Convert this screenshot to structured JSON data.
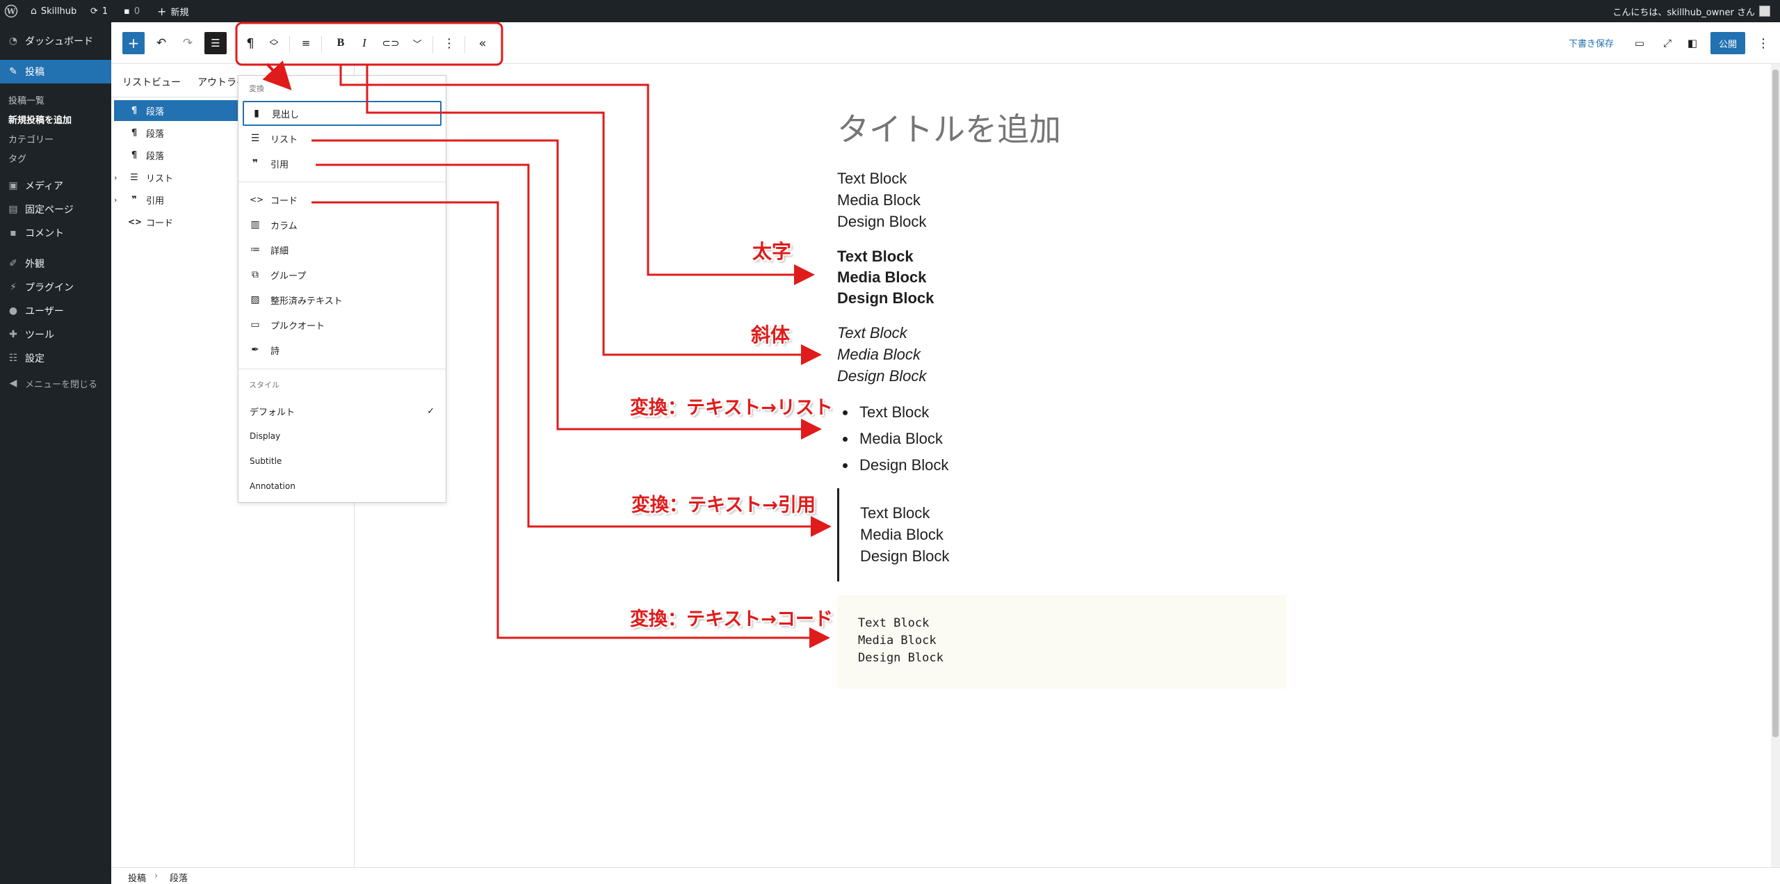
{
  "adminbar": {
    "site_name": "Skillhub",
    "updates_count": "1",
    "comments_count": "0",
    "new_label": "新規",
    "greeting": "こんにちは、skillhub_owner さん"
  },
  "adminmenu": {
    "dashboard": "ダッシュボード",
    "posts": "投稿",
    "posts_sub": [
      "投稿一覧",
      "新規投稿を追加",
      "カテゴリー",
      "タグ"
    ],
    "media": "メディア",
    "pages": "固定ページ",
    "comments": "コメント",
    "appearance": "外観",
    "plugins": "プラグイン",
    "users": "ユーザー",
    "tools": "ツール",
    "settings": "設定",
    "collapse": "メニューを閉じる"
  },
  "header": {
    "save_draft": "下書き保存",
    "publish": "公開"
  },
  "listview": {
    "tab_list": "リストビュー",
    "tab_outline": "アウトライ",
    "items": [
      {
        "icon": "¶",
        "label": "段落"
      },
      {
        "icon": "¶",
        "label": "段落"
      },
      {
        "icon": "¶",
        "label": "段落"
      },
      {
        "icon": "☰",
        "label": "リスト"
      },
      {
        "icon": "❞",
        "label": "引用"
      },
      {
        "icon": "<>",
        "label": "コード"
      }
    ]
  },
  "dropdown": {
    "transform_label": "変換",
    "items": [
      {
        "label": "見出し",
        "icon": "bookmark-icon"
      },
      {
        "label": "リスト",
        "icon": "list-icon"
      },
      {
        "label": "引用",
        "icon": "quote-icon"
      },
      {
        "label": "コード",
        "icon": "code-icon"
      },
      {
        "label": "カラム",
        "icon": "columns-icon"
      },
      {
        "label": "詳細",
        "icon": "details-icon"
      },
      {
        "label": "グループ",
        "icon": "group-icon"
      },
      {
        "label": "整形済みテキスト",
        "icon": "preformatted-icon"
      },
      {
        "label": "プルクオート",
        "icon": "pullquote-icon"
      },
      {
        "label": "詩",
        "icon": "verse-icon"
      }
    ],
    "style_label": "スタイル",
    "styles": [
      "デフォルト",
      "Display",
      "Subtitle",
      "Annotation"
    ]
  },
  "canvas": {
    "title_placeholder": "タイトルを追加",
    "paragraph": [
      "Text Block",
      "Media Block",
      "Design Block"
    ],
    "bold": [
      "Text Block",
      "Media Block",
      "Design Block"
    ],
    "italic": [
      "Text Block",
      "Media Block",
      "Design Block"
    ],
    "list": [
      "Text Block",
      "Media Block",
      "Design Block"
    ],
    "quote": [
      "Text Block",
      "Media Block",
      "Design Block"
    ],
    "code": [
      "Text Block",
      "Media Block",
      "Design Block"
    ]
  },
  "breadcrumb": {
    "root": "投稿",
    "current": "段落"
  },
  "annotations": {
    "bold": "太字",
    "italic": "斜体",
    "to_list": "変換：テキスト→リスト",
    "to_quote": "変換：テキスト→引用",
    "to_code": "変換：テキスト→コード"
  },
  "colors": {
    "accent": "#2271b1",
    "admin_dark": "#1d2327",
    "annotation_red": "#e01b1b"
  }
}
